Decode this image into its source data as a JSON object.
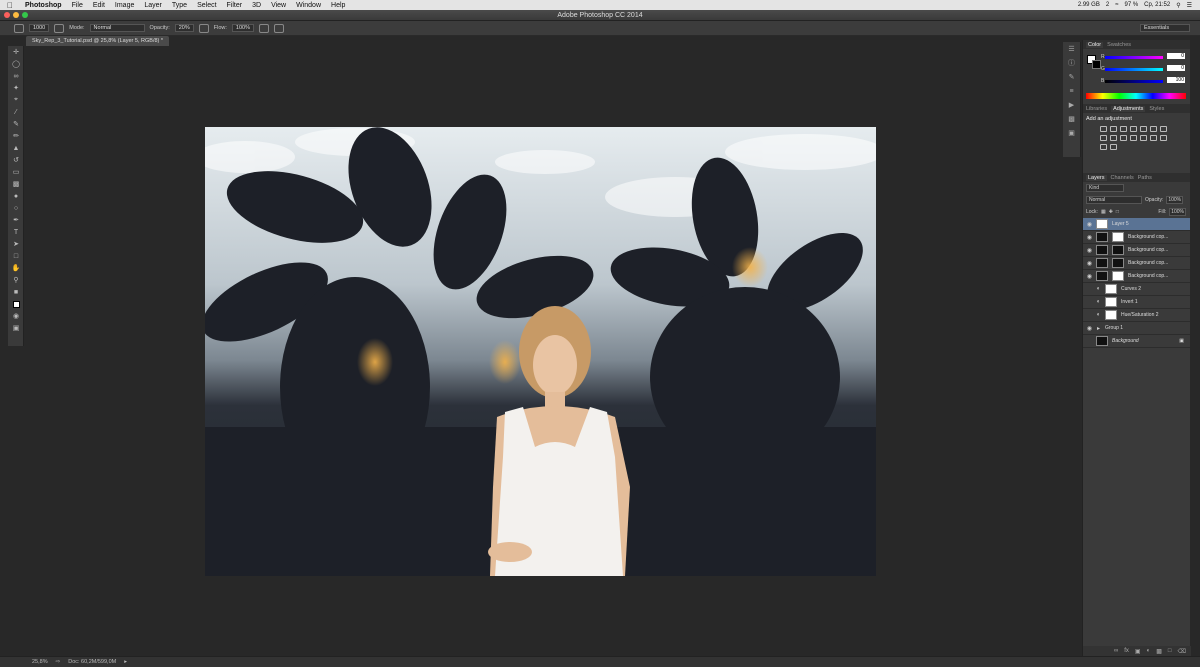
{
  "menubar": {
    "apple": "",
    "app_name": "Photoshop",
    "items": [
      "File",
      "Edit",
      "Image",
      "Layer",
      "Type",
      "Select",
      "Filter",
      "3D",
      "View",
      "Window",
      "Help"
    ],
    "memory": "2.99 GB",
    "workspace_indicator": "2",
    "battery": "97 %",
    "clock": "Ср, 21:52"
  },
  "window": {
    "title": "Adobe Photoshop CC 2014"
  },
  "options_bar": {
    "brush_size": "1000",
    "mode_label": "Mode:",
    "mode_value": "Normal",
    "opacity_label": "Opacity:",
    "opacity_value": "20%",
    "flow_label": "Flow:",
    "flow_value": "100%",
    "workspace": "Essentials"
  },
  "document_tab": "Sky_Rep_3_Tutorial.psd @ 25,8% (Layer 5, RGB/8) *",
  "status_bar": {
    "zoom": "25,8%",
    "doc": "Doc: 60,2M/599,0M"
  },
  "color_panel": {
    "tabs": [
      "Color",
      "Swatches"
    ],
    "r_label": "R",
    "r_value": "0",
    "g_label": "G",
    "g_value": "0",
    "b_label": "B",
    "b_value": "100"
  },
  "adjustments_panel": {
    "tabs": [
      "Libraries",
      "Adjustments",
      "Styles"
    ],
    "heading": "Add an adjustment"
  },
  "layers_panel": {
    "tabs": [
      "Layers",
      "Channels",
      "Paths"
    ],
    "kind": "Kind",
    "blend_mode": "Normal",
    "opacity_label": "Opacity:",
    "opacity_value": "100%",
    "lock_label": "Lock:",
    "fill_label": "Fill:",
    "fill_value": "100%",
    "layers": [
      {
        "name": "Layer 5",
        "selected": true
      },
      {
        "name": "Background cop..."
      },
      {
        "name": "Background cop..."
      },
      {
        "name": "Background cop..."
      },
      {
        "name": "Background cop..."
      },
      {
        "name": "Curves 2"
      },
      {
        "name": "Invert 1"
      },
      {
        "name": "Hue/Saturation 2"
      },
      {
        "name": "Group 1"
      },
      {
        "name": "Background"
      }
    ]
  },
  "colors": {
    "canvas_bg": "#282828",
    "selection": "#5a7394"
  }
}
